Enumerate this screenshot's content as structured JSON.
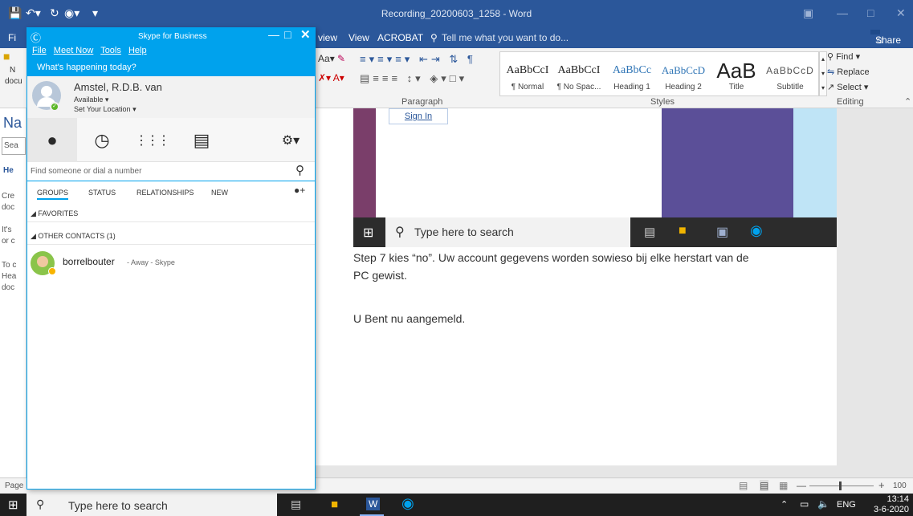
{
  "word": {
    "title": "Recording_20200603_1258 - Word",
    "tabs_visible": [
      "Fi",
      "view",
      "View",
      "ACROBAT"
    ],
    "tell_me": "Tell me what you want to do...",
    "share_label": "Share",
    "font_size_label": "Aa",
    "paragraph_group": "Paragraph",
    "styles_group": "Styles",
    "editing_group": "Editing",
    "find_label": "Find",
    "replace_label": "Replace",
    "select_label": "Select",
    "styles": [
      {
        "preview": "AaBbCcI",
        "name": "¶ Normal"
      },
      {
        "preview": "AaBbCcI",
        "name": "¶ No Spac..."
      },
      {
        "preview": "AaBbCc",
        "name": "Heading 1"
      },
      {
        "preview": "AaBbCcD",
        "name": "Heading 2"
      },
      {
        "preview": "AaB",
        "name": "Title"
      },
      {
        "preview": "AaBbCcD",
        "name": "Subtitle"
      }
    ],
    "nav_partial": [
      "N",
      "docu",
      "Na",
      "Sea",
      "He",
      "Cre",
      "doc",
      "It's",
      "or c",
      "To c",
      "Hea",
      "doc",
      "Page"
    ],
    "doc_lines": [
      "Step 7 kies “no”. Uw account gegevens worden sowieso bij elke herstart van de",
      "PC gewist.",
      "U Bent nu aangemeld."
    ],
    "embedded_sign_in": "Sign In",
    "embedded_search": "Type here to search",
    "zoom": "100"
  },
  "skype": {
    "app_title": "Skype for Business",
    "menu": [
      "File",
      "Meet Now",
      "Tools",
      "Help"
    ],
    "whats_happening": "What's happening today?",
    "user_name": "Amstel, R.D.B. van",
    "presence": "Available",
    "location": "Set Your Location",
    "search_placeholder": "Find someone or dial a number",
    "filters": [
      "GROUPS",
      "STATUS",
      "RELATIONSHIPS",
      "NEW"
    ],
    "groups": [
      {
        "label": "FAVORITES"
      },
      {
        "label": "OTHER CONTACTS (1)"
      }
    ],
    "contact": {
      "name": "borrelbouter",
      "status": " - Away - Skype"
    }
  },
  "taskbar": {
    "search": "Type here to search",
    "lang": "ENG",
    "time": "13:14",
    "date": "3-6-2020"
  }
}
